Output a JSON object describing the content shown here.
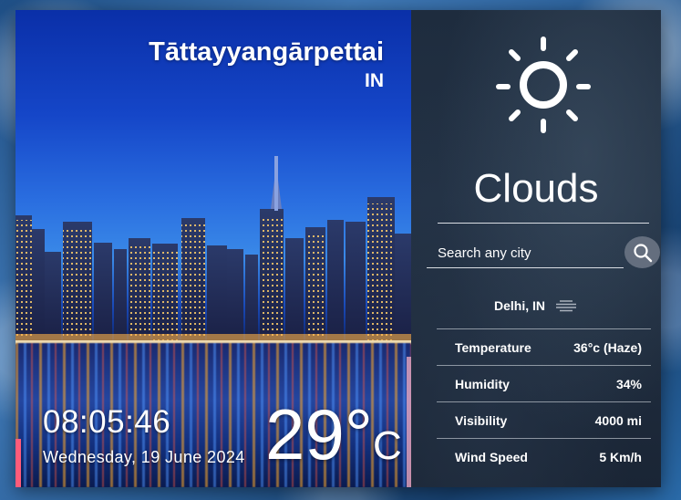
{
  "location": {
    "city": "Tāttayyangārpettai",
    "country": "IN"
  },
  "clock": {
    "time": "08:05:46",
    "date": "Wednesday, 19 June 2024"
  },
  "current_temp": {
    "value": "29°",
    "unit": "C"
  },
  "weather": {
    "icon": "sun-icon",
    "condition": "Clouds"
  },
  "search": {
    "placeholder": "Search any city",
    "value": ""
  },
  "selected_city": {
    "label": "Delhi, IN",
    "icon": "haze-icon"
  },
  "stats": [
    {
      "label": "Temperature",
      "value": "36°c (Haze)"
    },
    {
      "label": "Humidity",
      "value": "34%"
    },
    {
      "label": "Visibility",
      "value": "4000 mi"
    },
    {
      "label": "Wind Speed",
      "value": "5 Km/h"
    }
  ],
  "colors": {
    "panel_dark": "#1e2c3e",
    "sky_blue": "#1546c8",
    "accent_pink": "#ff5c7a"
  }
}
